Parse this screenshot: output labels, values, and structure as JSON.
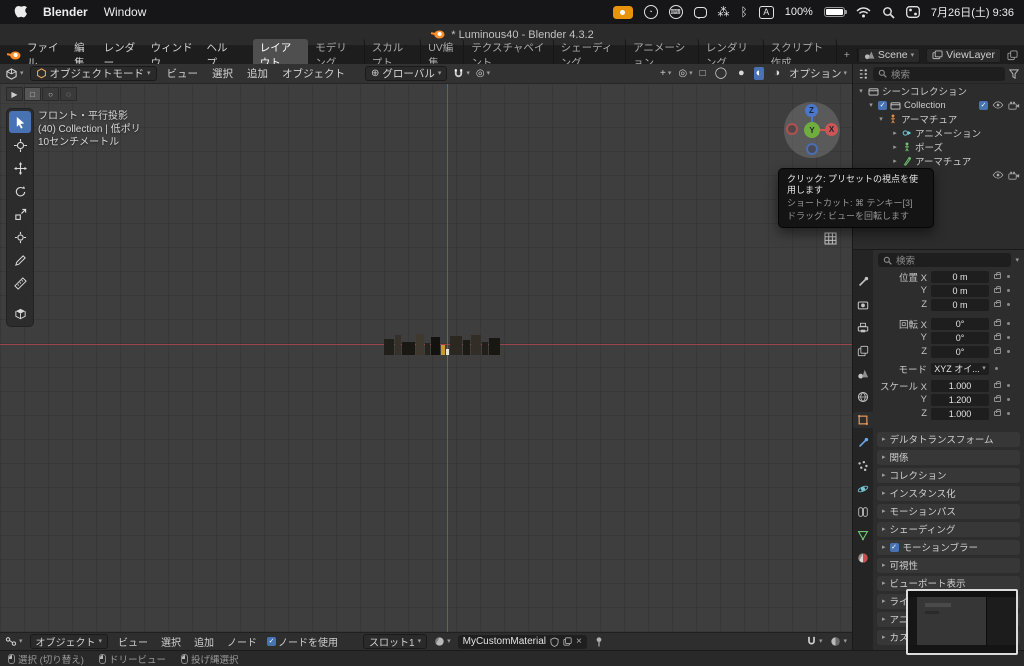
{
  "icons": {
    "dropdown": "▾",
    "check": "✓",
    "arrow_collapsed": "▸",
    "arrow_expanded": "▾",
    "overlay": "◎",
    "xray": "□",
    "shade_wire": "◯",
    "shade_solid": "●",
    "shade_material": "◐",
    "shade_render": "◑",
    "proportional": "◎",
    "globe": "⊕",
    "close": "×",
    "selmode_tweak": "▶",
    "selmode_box": "□",
    "selmode_circle": "○",
    "selmode_lasso": "◌",
    "bluetooth": "ᛒ",
    "paw": "⁂",
    "circle_badge": "◔"
  },
  "macos": {
    "app_name": "Blender",
    "menu_window": "Window",
    "battery_pct": "100%",
    "input_source": "A",
    "datetime": "7月26日(土) 9:36"
  },
  "titlebar": {
    "title": "* Luminous40 - Blender 4.3.2"
  },
  "topbar": {
    "menus": [
      "ファイル",
      "編集",
      "レンダー",
      "ウィンドウ",
      "ヘルプ"
    ],
    "workspaces": [
      "レイアウト",
      "モデリング",
      "スカルプト",
      "UV編集",
      "テクスチャペイント",
      "シェーディング",
      "アニメーション",
      "レンダリング",
      "スクリプト作成"
    ],
    "add_tab": "+",
    "scene_label": "Scene",
    "viewlayer_label": "ViewLayer"
  },
  "viewport_header": {
    "mode": "オブジェクトモード",
    "menus": [
      "ビュー",
      "選択",
      "追加",
      "オブジェクト"
    ],
    "orientation": "グローバル",
    "options_label": "オプション"
  },
  "viewport": {
    "info_view": "フロント・平行投影",
    "info_collection": "(40) Collection | 低ポリ",
    "info_scale": "10センチメートル",
    "axis_x_label": "X",
    "axis_y_label": "Y",
    "axis_z_label": "Z",
    "tooltip": {
      "line1": "クリック: プリセットの視点を使用します",
      "line2": "ショートカット: ⌘ テンキー[3]",
      "line3": "ドラッグ: ビューを回転します"
    }
  },
  "outliner": {
    "search_placeholder": "検索",
    "rows": [
      {
        "label": "シーンコレクション"
      },
      {
        "label": "Collection"
      },
      {
        "label": "アーマチュア"
      },
      {
        "label": "アニメーション"
      },
      {
        "label": "ポーズ"
      },
      {
        "label": "アーマチュア"
      },
      {
        "label": "低ポリ"
      }
    ]
  },
  "properties": {
    "search_placeholder": "検索",
    "rows": {
      "loc_label": "位置 X",
      "loc_x": "0 m",
      "loc_y": "0 m",
      "loc_z": "0 m",
      "rot_label": "回転 X",
      "rot_x": "0°",
      "rot_y": "0°",
      "rot_z": "0°",
      "mode_label": "モード",
      "mode_value": "XYZ オイ...",
      "scale_label": "スケール X",
      "scale_x": "1.000",
      "scale_y": "1.200",
      "scale_z": "1.000",
      "y_label": "Y",
      "z_label": "Z"
    },
    "sections": [
      "デルタトランスフォーム",
      "関係",
      "コレクション",
      "インスタンス化",
      "モーションパス",
      "シェーディング",
      "モーションブラー",
      "可視性",
      "ビューポート表示",
      "ライ",
      "アニ",
      "カス"
    ]
  },
  "shader_bar": {
    "mode": "オブジェクト",
    "menus": [
      "ビュー",
      "選択",
      "追加",
      "ノード"
    ],
    "use_nodes_label": "ノードを使用",
    "slot_label": "スロット1",
    "material_name": "MyCustomMaterial"
  },
  "statusbar": {
    "hints": [
      "選択 (切り替え)",
      "ドリービュー",
      "投げ縄選択"
    ]
  }
}
